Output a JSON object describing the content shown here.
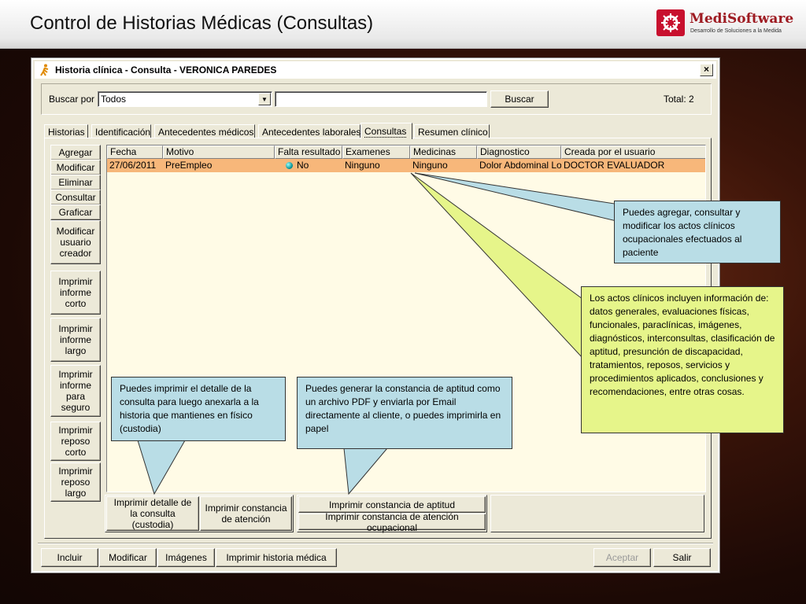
{
  "slide": {
    "title": "Control de Historias Médicas (Consultas)",
    "brand_name": "MediSoftware",
    "brand_tagline": "Desarrollo de Soluciones a la Medida"
  },
  "window": {
    "title": "Historia clínica - Consulta - VERONICA PAREDES",
    "close_label": "×"
  },
  "search": {
    "label": "Buscar por",
    "combo_value": "Todos",
    "input_value": "",
    "button": "Buscar",
    "total": "Total: 2"
  },
  "tabs": [
    "Historias",
    "Identificación",
    "Antecedentes médicos",
    "Antecedentes laborales",
    "Consultas",
    "Resumen clínico"
  ],
  "active_tab": "Consultas",
  "side_buttons": {
    "agregar": "Agregar",
    "modificar": "Modificar",
    "eliminar": "Eliminar",
    "consultar": "Consultar",
    "graficar": "Graficar",
    "modificar_usuario": "Modificar usuario creador",
    "informe_corto": "Imprimir informe corto",
    "informe_largo": "Imprimir informe largo",
    "informe_seguro": "Imprimir informe para seguro",
    "reposo_corto": "Imprimir reposo corto",
    "reposo_largo": "Imprimir reposo largo"
  },
  "table": {
    "columns": [
      "Fecha",
      "Motivo",
      "Falta resultado",
      "Examenes",
      "Medicinas",
      "Diagnostico",
      "Creada por el usuario"
    ],
    "rows": [
      [
        "27/06/2011",
        "PreEmpleo",
        "No",
        "Ninguno",
        "Ninguno",
        "Dolor Abdominal Localizado",
        "DOCTOR EVALUADOR"
      ]
    ]
  },
  "bottom_buttons": {
    "detalle": "Imprimir detalle de la consulta (custodia)",
    "constancia_atencion": "Imprimir constancia de atención",
    "constancia_aptitud": "Imprimir constancia de aptitud",
    "constancia_ocupacional": "Imprimir constancia de atención ocupacional"
  },
  "footer_buttons": {
    "incluir": "Incluir",
    "modificar": "Modificar",
    "imagenes": "Imágenes",
    "historia": "Imprimir historia médica",
    "aceptar": "Aceptar",
    "salir": "Salir"
  },
  "callouts": {
    "agregar": "Puedes agregar, consultar y modificar los actos clínicos ocupacionales efectuados al paciente",
    "actos": "Los actos clínicos incluyen información de: datos generales, evaluaciones físicas, funcionales, paraclínicas, imágenes, diagnósticos, interconsultas, clasificación de aptitud, presunción de discapacidad, tratamientos, reposos, servicios y procedimientos aplicados, conclusiones y recomendaciones, entre otras cosas.",
    "imprimir": "Puedes imprimir el detalle de la consulta para luego anexarla a la historia que mantienes en físico (custodia)",
    "constancia": "Puedes generar la constancia de aptitud como un archivo PDF y enviarla por Email directamente al cliente, o puedes imprimirla en papel"
  },
  "colors": {
    "selected_row": "#f7b77a",
    "callout_blue": "#b9dde6",
    "callout_green": "#e6f58a",
    "brand_red": "#c8102e"
  }
}
